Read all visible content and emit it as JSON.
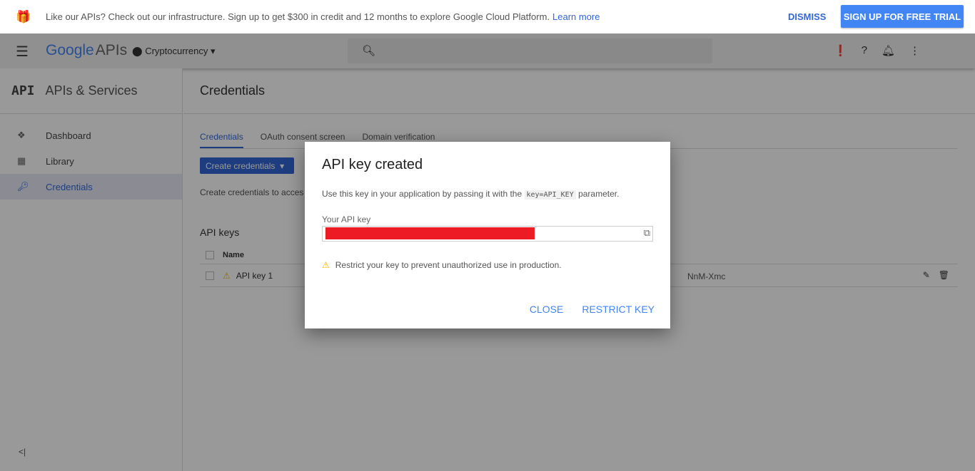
{
  "banner": {
    "text": "Like our APIs? Check out our infrastructure. Sign up to get $300 in credit and 12 months to explore Google Cloud Platform.",
    "learn_more": "Learn more",
    "dismiss": "DISMISS",
    "signup": "SIGN UP FOR FREE TRIAL"
  },
  "header": {
    "logo_google": "Google",
    "logo_apis": "APIs",
    "project": "Cryptocurrency"
  },
  "sidebar": {
    "title_icon": "API",
    "title": "APIs & Services",
    "items": [
      {
        "label": "Dashboard",
        "icon": "dashboard-icon"
      },
      {
        "label": "Library",
        "icon": "library-icon"
      },
      {
        "label": "Credentials",
        "icon": "key-icon",
        "active": true
      }
    ],
    "collapse": "<|"
  },
  "main": {
    "title": "Credentials",
    "tabs": [
      "Credentials",
      "OAuth consent screen",
      "Domain verification"
    ],
    "create_button": "Create credentials",
    "description": "Create credentials to acces",
    "api_keys_title": "API keys",
    "table": {
      "header": "Name",
      "rows": [
        {
          "name": "API key 1",
          "key_fragment": "NnM-Xmc"
        }
      ]
    }
  },
  "dialog": {
    "title": "API key created",
    "desc_before": "Use this key in your application by passing it with the",
    "desc_code": "key=API_KEY",
    "desc_after": "parameter.",
    "key_label": "Your API key",
    "warning": "Restrict your key to prevent unauthorized use in production.",
    "close": "CLOSE",
    "restrict": "RESTRICT KEY"
  },
  "colors": {
    "accent": "#4285f4",
    "primary": "#3367d6",
    "redaction": "#ed1c24",
    "warning": "#f4b400"
  }
}
